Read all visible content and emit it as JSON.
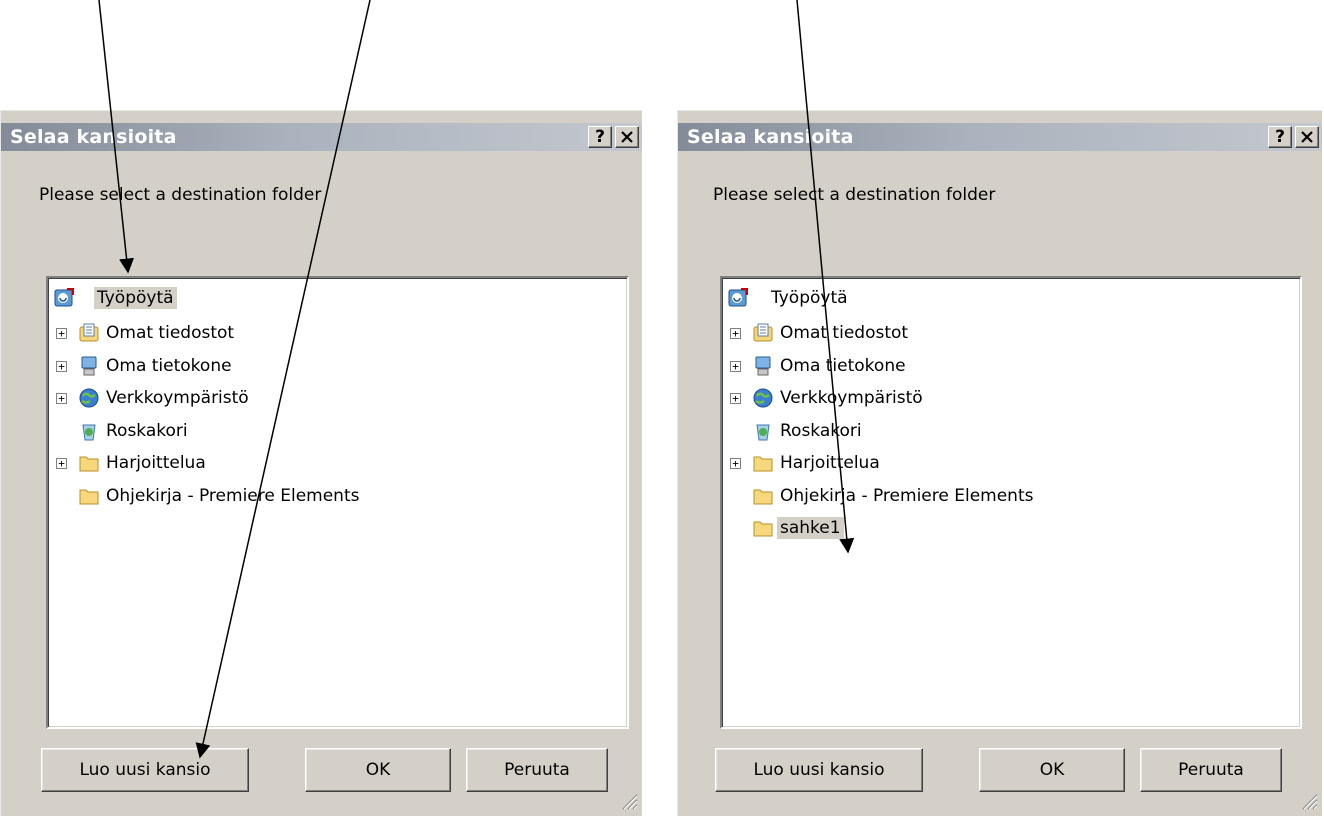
{
  "dialog_left": {
    "title": "Selaa kansioita",
    "help_label": "?",
    "close_label": "✕",
    "prompt": "Please select a destination folder",
    "tree": [
      {
        "label": "Työpöytä",
        "icon": "desktop-icon",
        "expander": "",
        "selected": true
      },
      {
        "label": "Omat tiedostot",
        "icon": "documents-folder-icon",
        "expander": "+"
      },
      {
        "label": "Oma tietokone",
        "icon": "computer-icon",
        "expander": "+"
      },
      {
        "label": "Verkkoympäristö",
        "icon": "network-icon",
        "expander": "+"
      },
      {
        "label": "Roskakori",
        "icon": "recycle-bin-icon",
        "expander": ""
      },
      {
        "label": "Harjoittelua",
        "icon": "folder-icon",
        "expander": "+"
      },
      {
        "label": "Ohjekirja - Premiere Elements",
        "icon": "folder-icon",
        "expander": ""
      }
    ],
    "buttons": {
      "new_folder": "Luo uusi kansio",
      "ok": "OK",
      "cancel": "Peruuta"
    }
  },
  "dialog_right": {
    "title": "Selaa kansioita",
    "help_label": "?",
    "close_label": "✕",
    "prompt": "Please select a destination folder",
    "tree": [
      {
        "label": "Työpöytä",
        "icon": "desktop-icon",
        "expander": ""
      },
      {
        "label": "Omat tiedostot",
        "icon": "documents-folder-icon",
        "expander": "+"
      },
      {
        "label": "Oma tietokone",
        "icon": "computer-icon",
        "expander": "+"
      },
      {
        "label": "Verkkoympäristö",
        "icon": "network-icon",
        "expander": "+"
      },
      {
        "label": "Roskakori",
        "icon": "recycle-bin-icon",
        "expander": ""
      },
      {
        "label": "Harjoittelua",
        "icon": "folder-icon",
        "expander": "+"
      },
      {
        "label": "Ohjekirja - Premiere Elements",
        "icon": "folder-icon",
        "expander": ""
      },
      {
        "label": "sahke1",
        "icon": "folder-icon",
        "expander": "",
        "selected": true
      }
    ],
    "buttons": {
      "new_folder": "Luo uusi kansio",
      "ok": "OK",
      "cancel": "Peruuta"
    }
  },
  "colors": {
    "dialog_bg": "#d4d0c8",
    "title_gradient_start": "#838b98",
    "title_gradient_end": "#c4c8cf",
    "selection_bg": "#d4d0c8"
  }
}
